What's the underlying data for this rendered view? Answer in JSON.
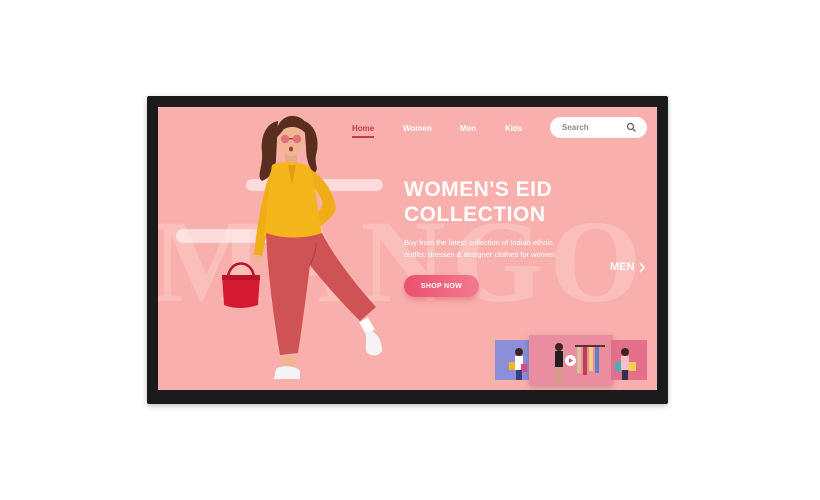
{
  "nav": {
    "home": "Home",
    "women": "Women",
    "men": "Men",
    "kids": "Kids"
  },
  "search": {
    "placeholder": "Search",
    "icon": "search-icon"
  },
  "hero": {
    "title_line1": "WOMEN'S EID",
    "title_line2": "COLLECTION",
    "description": "Buy from the latest collection of Indian ethnic outfits, dresses & designer clothes for women.",
    "cta_label": "SHOP NOW"
  },
  "side_link": {
    "label": "MEN",
    "icon": "chevron-right-icon"
  },
  "colors": {
    "background": "#f9b0ad",
    "accent": "#c63a55",
    "button": "#ee6580",
    "text": "#ffffff"
  }
}
